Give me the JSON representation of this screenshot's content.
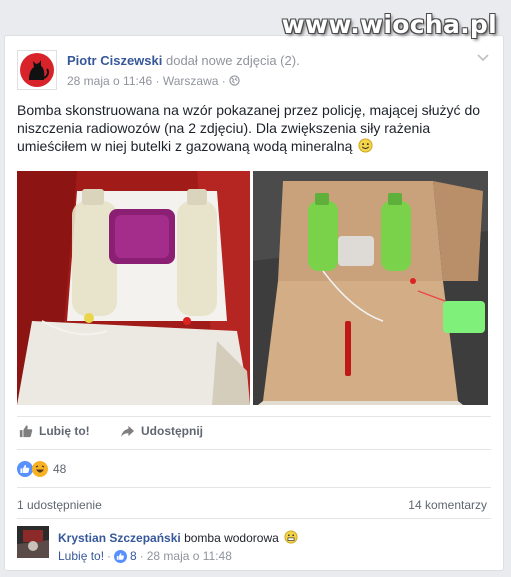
{
  "watermark": "www.wiocha.pl",
  "post": {
    "author": "Piotr Ciszewski",
    "action": " dodał nowe zdjęcia (2).",
    "date": "28 maja o 11:46",
    "separator": "·",
    "location": "Warszawa",
    "text": "Bomba skonstruowana na wzór pokazanej przez policję, mającej służyć do niszczenia radiowozów (na 2 zdjęciu). Dla zwiększenia siły rażenia umieściłem w niej butelki z gazowaną wodą mineralną",
    "photos": [
      {
        "icon": "photo-bottles-box-red-background"
      },
      {
        "icon": "photo-bottles-box-police-version"
      }
    ]
  },
  "actions": {
    "like_label": "Lubię to!",
    "share_label": "Udostępnij"
  },
  "reactions": {
    "icons": [
      "like-icon",
      "haha-icon"
    ],
    "count": "48"
  },
  "stats": {
    "shares": "1 udostępnienie",
    "comments": "14 komentarzy"
  },
  "comment": {
    "author": "Krystian Szczepański",
    "text": "bomba wodorowa",
    "like_label": "Lubię to!",
    "separator": "·",
    "likes": "8",
    "date": "28 maja o 11:48"
  },
  "colors": {
    "link": "#365899",
    "meta": "#90949c",
    "background": "#e9ebee",
    "like_blue": "#5890ff",
    "haha_yellow": "#f7b125"
  }
}
